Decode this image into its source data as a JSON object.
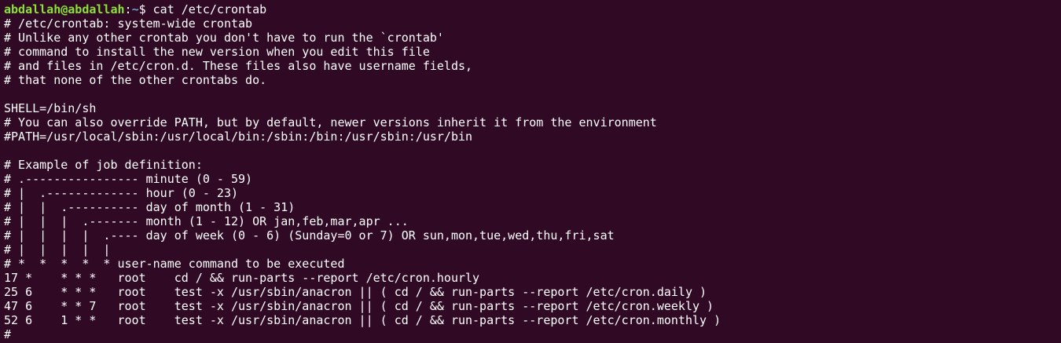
{
  "prompt": {
    "user_host": "abdallah@abdallah",
    "separator": ":",
    "cwd": "~",
    "symbol": "$ ",
    "command": "cat /etc/crontab"
  },
  "colors": {
    "background": "#300a24",
    "text": "#ffffff",
    "prompt_user": "#8ae234",
    "prompt_path": "#729fcf"
  },
  "output_lines": [
    "# /etc/crontab: system-wide crontab",
    "# Unlike any other crontab you don't have to run the `crontab'",
    "# command to install the new version when you edit this file",
    "# and files in /etc/cron.d. These files also have username fields,",
    "# that none of the other crontabs do.",
    "",
    "SHELL=/bin/sh",
    "# You can also override PATH, but by default, newer versions inherit it from the environment",
    "#PATH=/usr/local/sbin:/usr/local/bin:/sbin:/bin:/usr/sbin:/usr/bin",
    "",
    "# Example of job definition:",
    "# .---------------- minute (0 - 59)",
    "# |  .------------- hour (0 - 23)",
    "# |  |  .---------- day of month (1 - 31)",
    "# |  |  |  .------- month (1 - 12) OR jan,feb,mar,apr ...",
    "# |  |  |  |  .---- day of week (0 - 6) (Sunday=0 or 7) OR sun,mon,tue,wed,thu,fri,sat",
    "# |  |  |  |  |",
    "# *  *  *  *  * user-name command to be executed",
    "17 *    * * *   root    cd / && run-parts --report /etc/cron.hourly",
    "25 6    * * *   root    test -x /usr/sbin/anacron || ( cd / && run-parts --report /etc/cron.daily )",
    "47 6    * * 7   root    test -x /usr/sbin/anacron || ( cd / && run-parts --report /etc/cron.weekly )",
    "52 6    1 * *   root    test -x /usr/sbin/anacron || ( cd / && run-parts --report /etc/cron.monthly )",
    "#"
  ]
}
